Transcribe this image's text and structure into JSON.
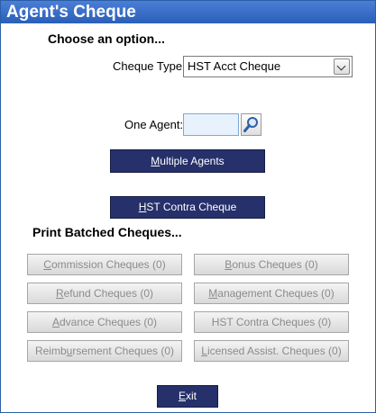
{
  "window": {
    "title": "Agent's Cheque"
  },
  "section_choose": "Choose an option...",
  "cheque_type": {
    "label": "Cheque Type:",
    "value": "HST Acct Cheque"
  },
  "one_agent": {
    "label": "One Agent:",
    "value": ""
  },
  "buttons": {
    "multiple_agents": {
      "accel": "M",
      "rest": "ultiple Agents"
    },
    "hst_contra_cheque": {
      "accel": "H",
      "rest": "ST Contra Cheque"
    },
    "exit": {
      "accel": "E",
      "rest": "xit"
    }
  },
  "section_print": "Print Batched Cheques...",
  "batched": {
    "commission": {
      "accel": "C",
      "rest": "ommission Cheques (0)"
    },
    "bonus": {
      "accel": "B",
      "rest": "onus Cheques (0)"
    },
    "refund": {
      "accel": "R",
      "rest": "efund Cheques (0)"
    },
    "management": {
      "accel": "M",
      "rest": "anagement Cheques (0)"
    },
    "advance": {
      "accel": "A",
      "rest": "dvance Cheques (0)"
    },
    "hst_contra": {
      "text": "HST Contra Cheques (0)"
    },
    "reimbursement": {
      "pre": "Reimb",
      "accel": "u",
      "rest": "rsement Cheques (0)"
    },
    "licensed_assist": {
      "accel": "L",
      "rest": "icensed Assist. Cheques (0)"
    }
  },
  "icons": {
    "search": "magnifier-icon",
    "dropdown": "chevron-down-icon"
  },
  "colors": {
    "title_bar": "#2a5fb8",
    "action_button": "#26306a",
    "disabled_text": "#8b8b8b"
  }
}
